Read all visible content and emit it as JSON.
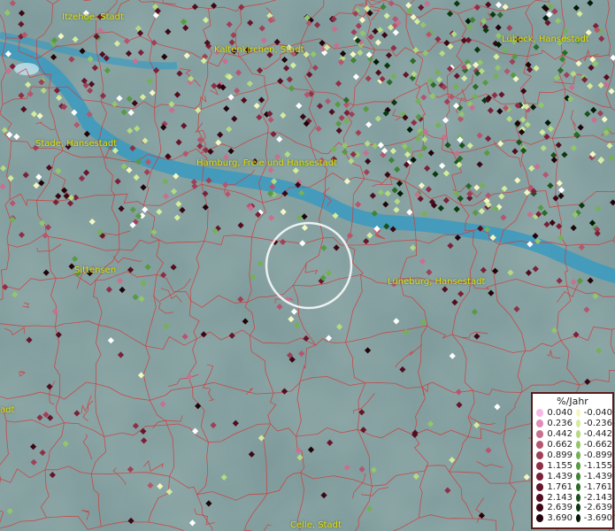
{
  "towns": [
    {
      "id": "itzehoe",
      "label": "Itzehoe, Stadt"
    },
    {
      "id": "kaltenkirchen",
      "label": "Kaltenkirchen, Stadt"
    },
    {
      "id": "luebeck",
      "label": "Lübeck, Hansestadt"
    },
    {
      "id": "stade",
      "label": "Stade, Hansestadt"
    },
    {
      "id": "hamburg",
      "label": "Hamburg, Freie und Hansestadt"
    },
    {
      "id": "sittensen",
      "label": "Sittensen"
    },
    {
      "id": "lueneburg",
      "label": "Lüneburg, Hansestadt"
    },
    {
      "id": "celle",
      "label": "Celle, Stadt"
    },
    {
      "id": "stadt-edge",
      "label": "adt"
    }
  ],
  "legend": {
    "title": "%/Jahr",
    "positive": [
      {
        "value": "0.040",
        "color": "#f7b8e6"
      },
      {
        "value": "0.236",
        "color": "#e08cb8"
      },
      {
        "value": "0.442",
        "color": "#c8708f"
      },
      {
        "value": "0.662",
        "color": "#b5566f"
      },
      {
        "value": "0.899",
        "color": "#a04058"
      },
      {
        "value": "1.155",
        "color": "#8e2f47"
      },
      {
        "value": "1.439",
        "color": "#7a2138"
      },
      {
        "value": "1.761",
        "color": "#66162b"
      },
      {
        "value": "2.143",
        "color": "#520e20"
      },
      {
        "value": "2.639",
        "color": "#3c0715"
      },
      {
        "value": "3.690",
        "color": "#22030a"
      }
    ],
    "negative": [
      {
        "value": "-0.040",
        "color": "#f4f7c2"
      },
      {
        "value": "-0.236",
        "color": "#d4ec9c"
      },
      {
        "value": "-0.442",
        "color": "#b4da82"
      },
      {
        "value": "-0.662",
        "color": "#93c66a"
      },
      {
        "value": "-0.899",
        "color": "#74b156"
      },
      {
        "value": "-1.155",
        "color": "#589a44"
      },
      {
        "value": "-1.439",
        "color": "#3f8335"
      },
      {
        "value": "-1.761",
        "color": "#2b6b28"
      },
      {
        "value": "-2.143",
        "color": "#1a521c"
      },
      {
        "value": "-2.639",
        "color": "#0c3810"
      },
      {
        "value": "-3.690",
        "color": "#031a05"
      }
    ]
  },
  "colors": {
    "land": "#7f9a9a",
    "water": "#3a9ac0",
    "boundary": "#d23a3a",
    "label": "#e8e000",
    "highlight_ring": "#ffffff",
    "point_white": "#ffffff"
  }
}
